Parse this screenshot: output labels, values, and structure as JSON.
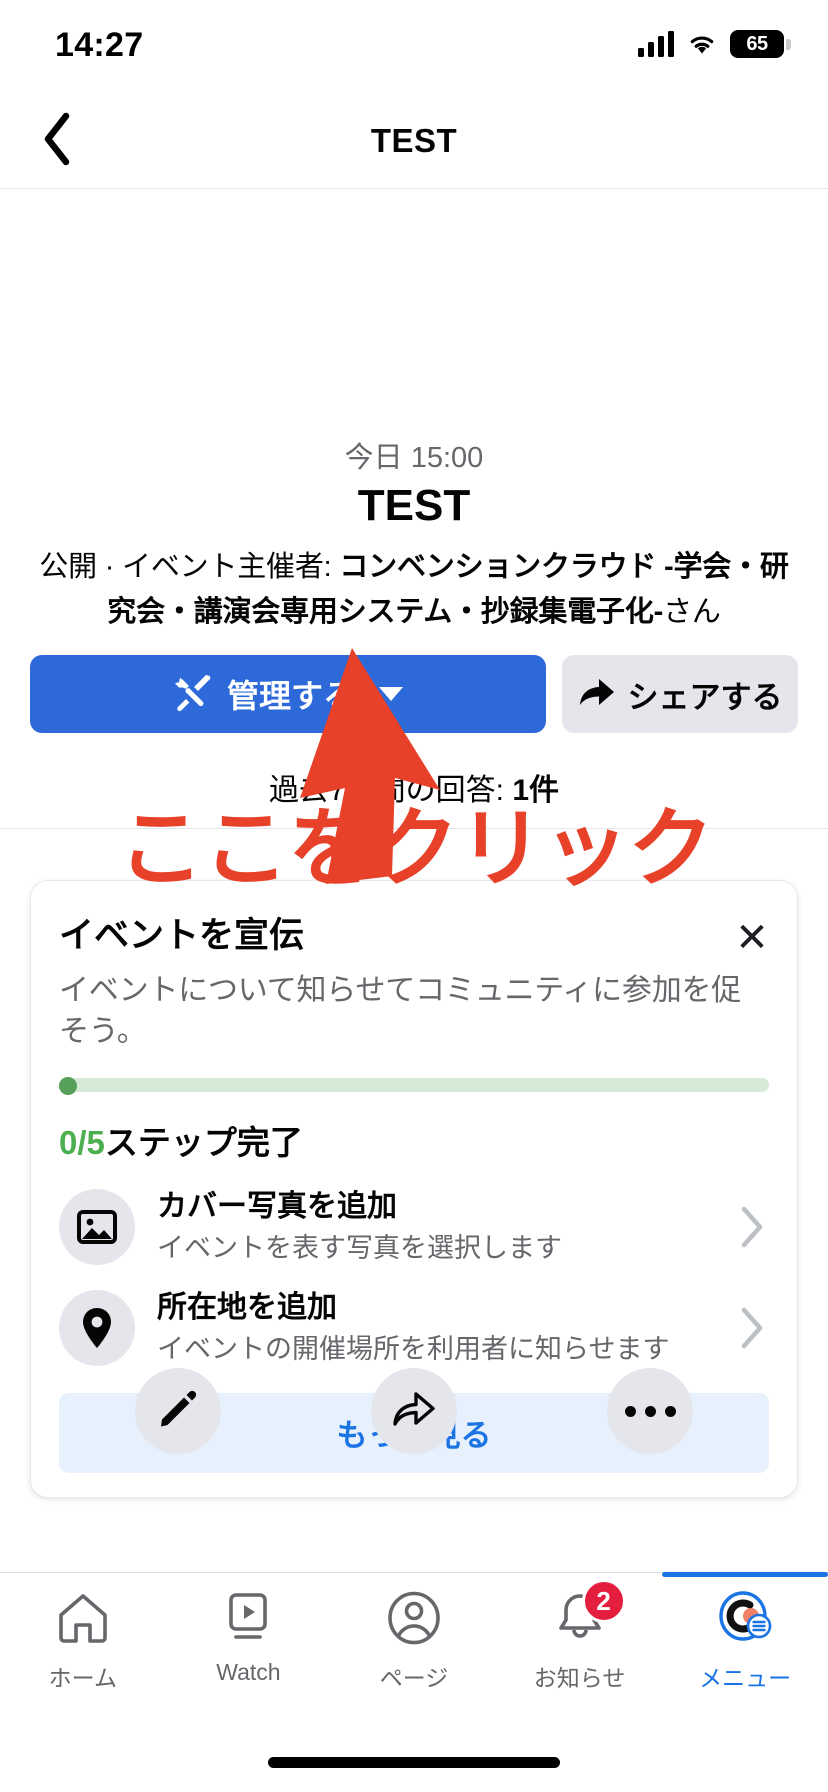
{
  "status_bar": {
    "time": "14:27",
    "battery_percent": "65",
    "icons": [
      "signal-bars-icon",
      "wifi-icon",
      "battery-icon"
    ]
  },
  "nav": {
    "back_icon": "chevron-left-icon",
    "title": "TEST"
  },
  "event": {
    "when": "今日 15:00",
    "title": "TEST",
    "host_line": "公開 · イベント主催者: ",
    "host_name": "コンベンションクラウド -学会・研究会・講演会専用システム・抄録集電子化-",
    "host_suffix": "さん",
    "manage_button": "管理する",
    "manage_icon": "tools-icon",
    "manage_caret": "chevron-down-icon",
    "share_button": "シェアする",
    "share_icon": "share-arrow-icon",
    "responses_prefix": "過去7日間の回答: ",
    "responses_count": "1件"
  },
  "promo_card": {
    "title": "イベントを宣伝",
    "close_icon": "close-icon",
    "close_label": "✕",
    "description": "イベントについて知らせてコミュニティに参加を促そう。",
    "progress_value": 0,
    "progress_total": 5,
    "steps_fraction": "0/5",
    "steps_label": "ステップ完了",
    "progress_track_color": "#d7ead7",
    "progress_dot_color": "#57a05a",
    "steps_accent_color": "#4caf50",
    "steps": [
      {
        "icon": "image-icon",
        "title": "カバー写真を追加",
        "subtitle": "イベントを表す写真を選択します",
        "chevron": "chevron-right-icon"
      },
      {
        "icon": "location-pin-icon",
        "title": "所在地を追加",
        "subtitle": "イベントの開催場所を利用者に知らせます",
        "chevron": "chevron-right-icon"
      }
    ],
    "more_button": "もっと見る"
  },
  "floating_actions": [
    {
      "icon": "pencil-icon"
    },
    {
      "icon": "share-icon"
    },
    {
      "icon": "more-dots-icon"
    }
  ],
  "tab_bar": {
    "items": [
      {
        "label": "ホーム",
        "icon": "home-icon",
        "active": false,
        "badge": ""
      },
      {
        "label": "Watch",
        "icon": "watch-video-icon",
        "active": false,
        "badge": ""
      },
      {
        "label": "ページ",
        "icon": "pages-profile-icon",
        "active": false,
        "badge": ""
      },
      {
        "label": "お知らせ",
        "icon": "bell-icon",
        "active": false,
        "badge": "2"
      },
      {
        "label": "メニュー",
        "icon": "menu-avatar-icon",
        "active": true,
        "badge": ""
      }
    ],
    "active_color": "#1b74e4",
    "badge_color": "#e41e3f"
  },
  "annotation": {
    "text": "ここをクリック",
    "color": "#e8412a",
    "arrow": "up-arrow-pointing-to-manage-button"
  },
  "colors": {
    "primary_blue": "#2d69d8",
    "link_blue": "#1b74e4",
    "grey_button": "#e4e6eb",
    "text_primary": "#050505",
    "text_secondary": "#65676b"
  }
}
